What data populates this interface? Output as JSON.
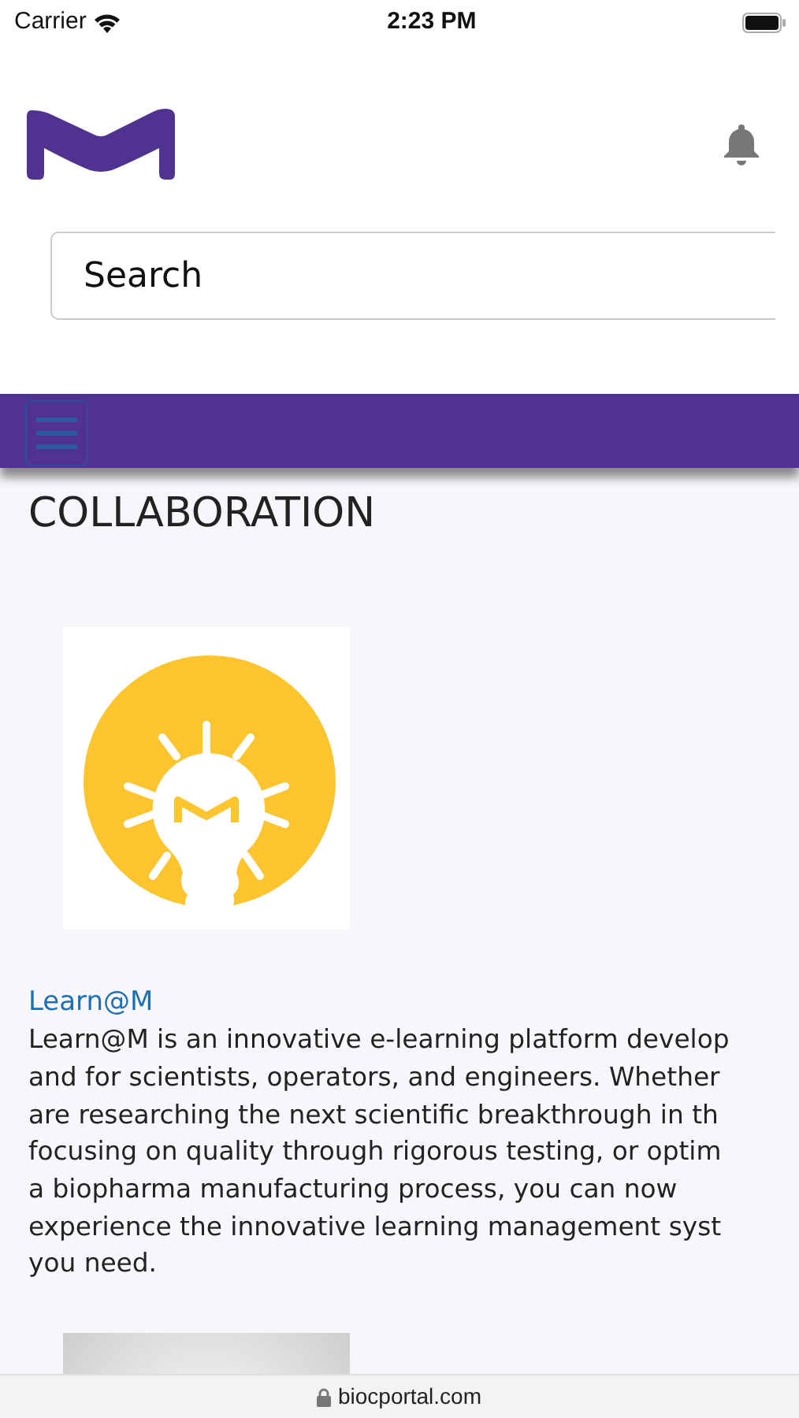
{
  "status_bar": {
    "carrier": "Carrier",
    "time": "2:23 PM"
  },
  "header": {
    "search": {
      "placeholder": "Search"
    }
  },
  "section": {
    "title": "COLLABORATION"
  },
  "cards": [
    {
      "kind": "lightbulb",
      "title": "Learn@M",
      "description_lines": [
        "Learn@M is an innovative e-learning platform develop",
        "and for scientists, operators, and engineers. Whether",
        "are researching the next scientific breakthrough in th",
        "focusing on quality through rigorous testing, or optim",
        "a biopharma manufacturing process, you can now",
        "experience the innovative learning management syst",
        "you need."
      ]
    },
    {
      "kind": "picture"
    }
  ],
  "address_bar": {
    "url": "biocportal.com"
  }
}
